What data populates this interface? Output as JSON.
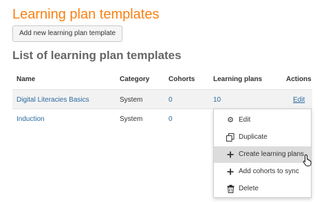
{
  "page": {
    "title": "Learning plan templates",
    "add_button": "Add new learning plan template",
    "section_title": "List of learning plan templates"
  },
  "table": {
    "headers": [
      "Name",
      "Category",
      "Cohorts",
      "Learning plans",
      "Actions"
    ],
    "rows": [
      {
        "name": "Digital Literacies Basics",
        "category": "System",
        "cohorts": "0",
        "plans": "10",
        "action": "Edit"
      },
      {
        "name": "Induction",
        "category": "System",
        "cohorts": "0",
        "plans": "",
        "action": ""
      }
    ]
  },
  "menu": {
    "items": [
      {
        "label": "Edit",
        "icon": "gear-icon"
      },
      {
        "label": "Duplicate",
        "icon": "copy-icon"
      },
      {
        "label": "Create learning plans",
        "icon": "plus-icon",
        "active": true
      },
      {
        "label": "Add cohorts to sync",
        "icon": "plus-icon"
      },
      {
        "label": "Delete",
        "icon": "trash-icon"
      }
    ]
  },
  "colors": {
    "title": "#f98012",
    "link": "#2a6aa0",
    "row_stripe": "#f2f2f2",
    "menu_active": "#dcdcdc"
  }
}
